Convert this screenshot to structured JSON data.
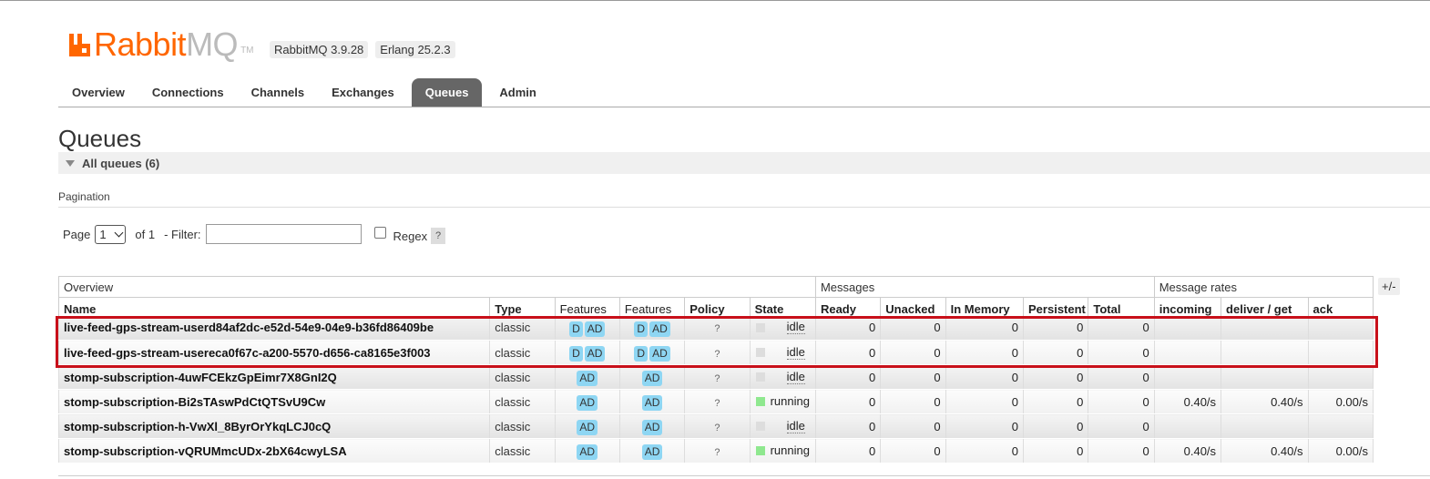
{
  "header": {
    "logo_rabbit": "Rabbit",
    "logo_mq": "MQ",
    "logo_tm": "TM",
    "rabbitmq_version": "RabbitMQ 3.9.28",
    "erlang_version": "Erlang 25.2.3"
  },
  "tabs": [
    {
      "label": "Overview",
      "active": false
    },
    {
      "label": "Connections",
      "active": false
    },
    {
      "label": "Channels",
      "active": false
    },
    {
      "label": "Exchanges",
      "active": false
    },
    {
      "label": "Queues",
      "active": true
    },
    {
      "label": "Admin",
      "active": false
    }
  ],
  "page": {
    "title": "Queues",
    "section_label": "All queues (6)",
    "pagination_label": "Pagination",
    "page_label": "Page",
    "page_value": "1",
    "of_label": "of 1",
    "filter_label": "- Filter:",
    "filter_value": "",
    "regex_label": "Regex",
    "regex_checked": false,
    "help_label": "?",
    "plus_minus": "+/-"
  },
  "table": {
    "groups": {
      "overview": "Overview",
      "messages": "Messages",
      "message_rates": "Message rates"
    },
    "columns": [
      "Name",
      "Type",
      "Features",
      "Features",
      "Policy",
      "State",
      "Ready",
      "Unacked",
      "In Memory",
      "Persistent",
      "Total",
      "incoming",
      "deliver / get",
      "ack"
    ],
    "rows": [
      {
        "name": "live-feed-gps-stream-userd84af2dc-e52d-54e9-04e9-b36fd86409be",
        "type": "classic",
        "features1": [
          "D",
          "AD"
        ],
        "features2": [
          "D",
          "AD"
        ],
        "policy": "?",
        "state": "idle",
        "ready": "0",
        "unacked": "0",
        "in_memory": "0",
        "persistent": "0",
        "total": "0",
        "incoming": "",
        "deliver_get": "",
        "ack": ""
      },
      {
        "name": "live-feed-gps-stream-usereca0f67c-a200-5570-d656-ca8165e3f003",
        "type": "classic",
        "features1": [
          "D",
          "AD"
        ],
        "features2": [
          "D",
          "AD"
        ],
        "policy": "?",
        "state": "idle",
        "ready": "0",
        "unacked": "0",
        "in_memory": "0",
        "persistent": "0",
        "total": "0",
        "incoming": "",
        "deliver_get": "",
        "ack": ""
      },
      {
        "name": "stomp-subscription-4uwFCEkzGpEimr7X8GnI2Q",
        "type": "classic",
        "features1": [
          "AD"
        ],
        "features2": [
          "AD"
        ],
        "policy": "?",
        "state": "idle",
        "ready": "0",
        "unacked": "0",
        "in_memory": "0",
        "persistent": "0",
        "total": "0",
        "incoming": "",
        "deliver_get": "",
        "ack": ""
      },
      {
        "name": "stomp-subscription-Bi2sTAswPdCtQTSvU9Cw",
        "type": "classic",
        "features1": [
          "AD"
        ],
        "features2": [
          "AD"
        ],
        "policy": "?",
        "state": "running",
        "ready": "0",
        "unacked": "0",
        "in_memory": "0",
        "persistent": "0",
        "total": "0",
        "incoming": "0.40/s",
        "deliver_get": "0.40/s",
        "ack": "0.00/s"
      },
      {
        "name": "stomp-subscription-h-VwXl_8ByrOrYkqLCJ0cQ",
        "type": "classic",
        "features1": [
          "AD"
        ],
        "features2": [
          "AD"
        ],
        "policy": "?",
        "state": "idle",
        "ready": "0",
        "unacked": "0",
        "in_memory": "0",
        "persistent": "0",
        "total": "0",
        "incoming": "",
        "deliver_get": "",
        "ack": ""
      },
      {
        "name": "stomp-subscription-vQRUMmcUDx-2bX64cwyLSA",
        "type": "classic",
        "features1": [
          "AD"
        ],
        "features2": [
          "AD"
        ],
        "policy": "?",
        "state": "running",
        "ready": "0",
        "unacked": "0",
        "in_memory": "0",
        "persistent": "0",
        "total": "0",
        "incoming": "0.40/s",
        "deliver_get": "0.40/s",
        "ack": "0.00/s"
      }
    ]
  },
  "colors": {
    "brand_orange": "#ff6600",
    "highlight_red": "#c8101a",
    "feature_badge": "#8ed6f3",
    "running_green": "#8fe88f",
    "idle_grey": "#dddddd",
    "active_tab": "#666666"
  }
}
